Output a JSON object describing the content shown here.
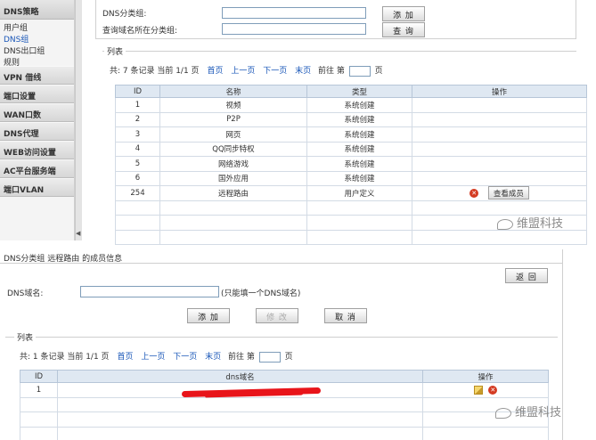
{
  "sidebar": {
    "header": "DNS策略",
    "subitems": [
      "用户组",
      "DNS组",
      "DNS出口组",
      "规则"
    ],
    "items": [
      "VPN 借线",
      "端口设置",
      "WAN口数",
      "DNS代理",
      "WEB访问设置",
      "AC平台服务端",
      "端口VLAN"
    ],
    "arrow": "◀"
  },
  "top_form": {
    "group_label": "DNS分类组:",
    "domain_label": "查询域名所在分类组:",
    "add_button": "添 加",
    "query_button": "查 询"
  },
  "top_list": {
    "legend": "列表",
    "pager": {
      "summary": "共: 7 条记录 当前 1/1 页",
      "first": "首页",
      "prev": "上一页",
      "next": "下一页",
      "last": "末页",
      "goto": "前往 第",
      "page_suffix": "页"
    },
    "headers": [
      "ID",
      "名称",
      "类型",
      "操作"
    ],
    "rows": [
      {
        "id": "1",
        "name": "视频",
        "type": "系统创建"
      },
      {
        "id": "2",
        "name": "P2P",
        "type": "系统创建"
      },
      {
        "id": "3",
        "name": "网页",
        "type": "系统创建"
      },
      {
        "id": "4",
        "name": "QQ同步特权",
        "type": "系统创建"
      },
      {
        "id": "5",
        "name": "网络游戏",
        "type": "系统创建"
      },
      {
        "id": "6",
        "name": "国外应用",
        "type": "系统创建"
      },
      {
        "id": "254",
        "name": "远程路由",
        "type": "用户定义",
        "action": "查看成员"
      }
    ]
  },
  "watermark": "维盟科技",
  "bottom": {
    "title": "DNS分类组 远程路由 的成员信息",
    "back_button": "返 回",
    "domain_label": "DNS域名:",
    "hint": "(只能填一个DNS域名)",
    "add_button": "添 加",
    "modify_button": "修 改",
    "cancel_button": "取 消",
    "legend": "列表",
    "pager": {
      "summary": "共: 1 条记录 当前 1/1 页",
      "first": "首页",
      "prev": "上一页",
      "next": "下一页",
      "last": "末页",
      "goto": "前往 第",
      "page_suffix": "页"
    },
    "headers": [
      "ID",
      "dns域名",
      "操作"
    ],
    "rows": [
      {
        "id": "1"
      }
    ]
  },
  "colors": {
    "link": "#1a57b8",
    "scribble": "#e8141a",
    "delete": "#d43b22",
    "header_bg": "#dfe8f2"
  }
}
